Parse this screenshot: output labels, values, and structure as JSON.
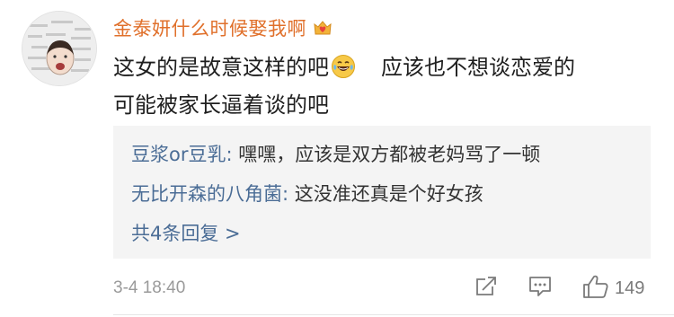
{
  "comment": {
    "username": "金泰妍什么时候娶我啊",
    "badge_icon": "crown-heart-badge-icon",
    "text_part1": "这女的是故意这样的吧",
    "text_emoji": "laughing-tears-emoji-icon",
    "text_part2": "应该也不想谈恋爱的",
    "text_line2": "可能被家长逼着谈的吧",
    "timestamp": "3-4 18:40",
    "like_count": "149"
  },
  "replies": {
    "items": [
      {
        "name": "豆浆or豆乳",
        "colon": ": ",
        "text": "嘿嘿，应该是双方都被老妈骂了一顿"
      },
      {
        "name": "无比开森的八角菌",
        "colon": ": ",
        "text": "这没准还真是个好女孩"
      }
    ],
    "more_label": "共4条回复 >"
  },
  "icons": {
    "share": "share-icon",
    "comment": "comment-icon",
    "like": "thumbs-up-icon"
  },
  "colors": {
    "username": "#e0702b",
    "reply_name": "#4b6d96",
    "reply_bg": "#f4f4f4",
    "meta": "#9a9a9a"
  }
}
